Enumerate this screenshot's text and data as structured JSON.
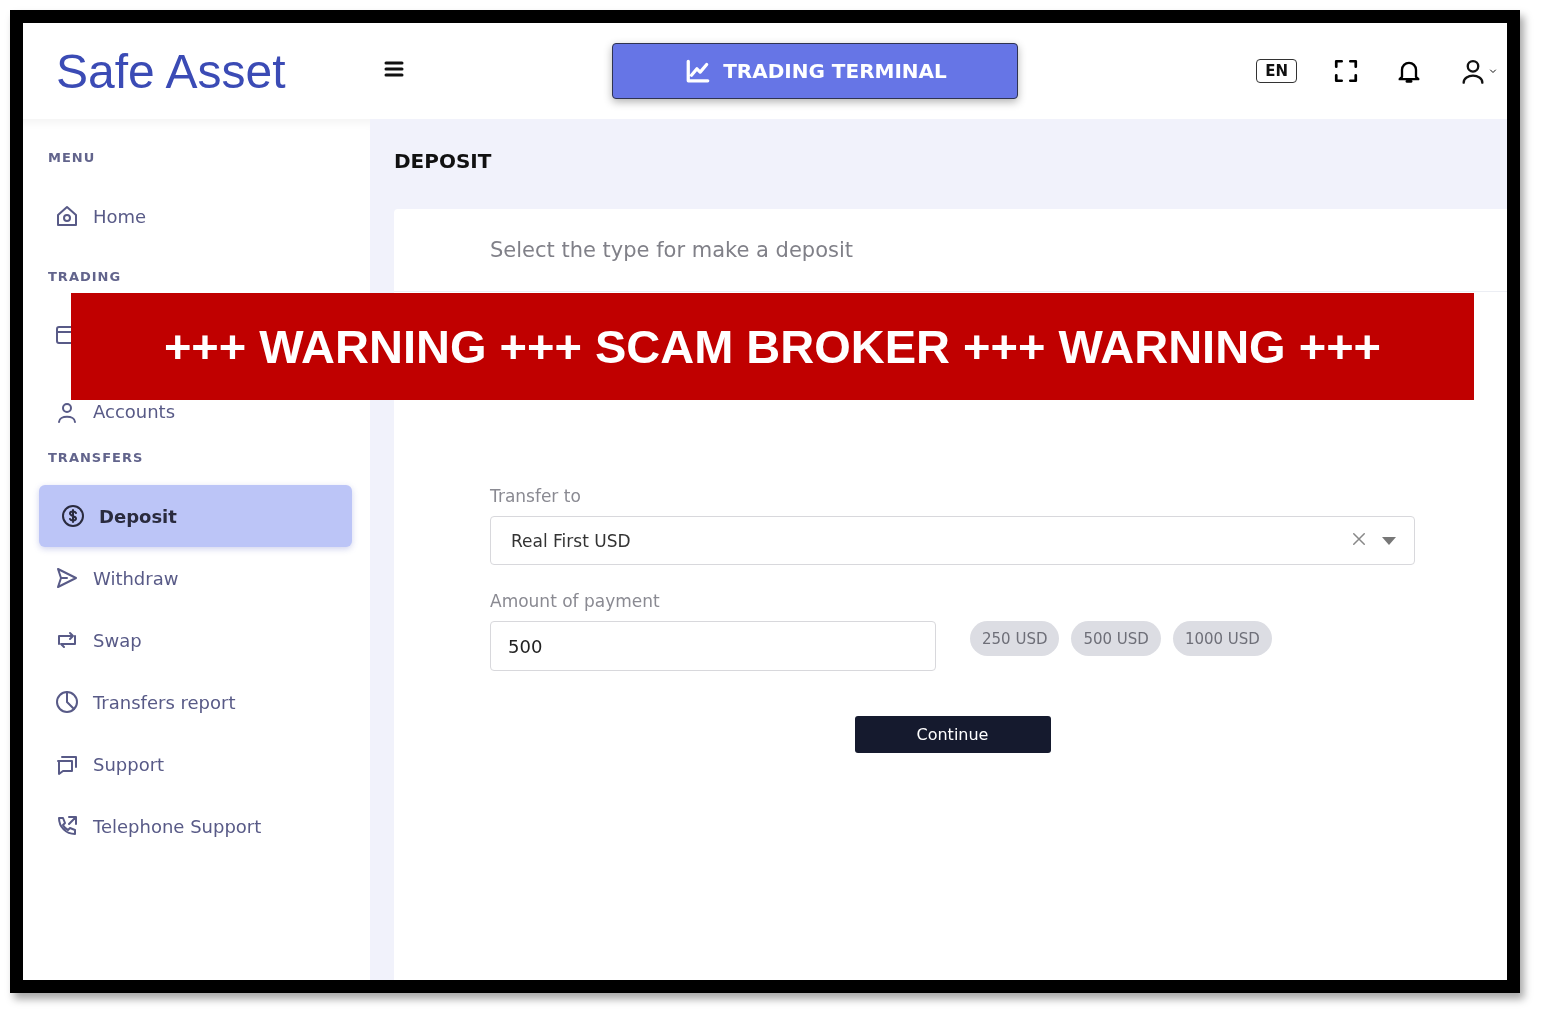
{
  "header": {
    "logo": "Safe Asset",
    "terminal_button": "TRADING TERMINAL",
    "language": "EN"
  },
  "sidebar": {
    "sections": [
      {
        "title": "MENU",
        "items": [
          {
            "label": "Home",
            "selected": false
          }
        ]
      },
      {
        "title": "TRADING",
        "items": [
          {
            "selected": false
          },
          {
            "label": "Accounts",
            "selected": false
          }
        ]
      },
      {
        "title": "TRANSFERS",
        "items": [
          {
            "label": "Deposit",
            "selected": true
          },
          {
            "label": "Withdraw",
            "selected": false
          },
          {
            "label": "Swap",
            "selected": false
          },
          {
            "label": "Transfers report",
            "selected": false
          },
          {
            "label": "Support",
            "selected": false
          },
          {
            "label": "Telephone Support",
            "selected": false
          }
        ]
      }
    ]
  },
  "page_title": "DEPOSIT",
  "deposit_card": {
    "heading": "Select the type for make a deposit",
    "transfer_to": {
      "label": "Transfer to",
      "value": "Real First USD"
    },
    "amount": {
      "label": "Amount of payment",
      "value": "500"
    },
    "presets": [
      "250 USD",
      "500 USD",
      "1000 USD"
    ],
    "continue_button": "Continue"
  },
  "warning_banner": "+++ WARNING +++ SCAM BROKER +++ WARNING +++"
}
